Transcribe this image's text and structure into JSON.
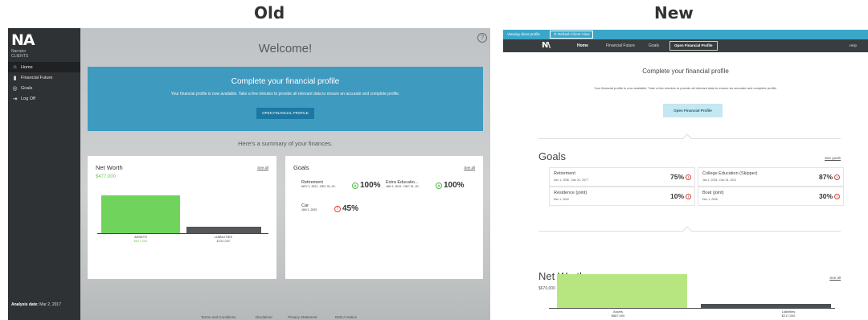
{
  "headings": {
    "old": "Old",
    "new": "New"
  },
  "old": {
    "logo": "NA",
    "logo_sub": "Narrator\nCLIENTS",
    "nav": [
      {
        "label": "Home",
        "icon": "home-icon",
        "glyph": "⌂"
      },
      {
        "label": "Financial Future",
        "icon": "chart-bar-icon",
        "glyph": "▮"
      },
      {
        "label": "Goals",
        "icon": "target-icon",
        "glyph": "◎"
      },
      {
        "label": "Log Off",
        "icon": "logout-icon",
        "glyph": "⇥"
      }
    ],
    "analysis_label": "Analysis date:",
    "analysis_date": "Mar 2, 2017",
    "help": "?",
    "welcome": "Welcome!",
    "banner": {
      "title": "Complete your financial profile",
      "text": "Your financial profile is now available. Take a few minutes to provide all relevant data to ensure an accurate and complete profile.",
      "button": "OPEN FINANCIAL PROFILE"
    },
    "summary": "Here's a summary of your finances.",
    "net_worth": {
      "title": "Net Worth",
      "see_all": "See all",
      "value": "$477,000",
      "assets_label": "ASSETS",
      "assets_value": "$627,000",
      "liabilities_label": "LIABILITIES",
      "liabilities_value": "$150,000",
      "assets_amount": 627000,
      "liabilities_amount": 150000
    },
    "goals": {
      "title": "Goals",
      "see_all": "See all",
      "items": [
        {
          "name": "Retirement",
          "dates": "NOV 1, 2021 - DEC 31, 20..",
          "pct": "100%",
          "status": "ok",
          "status_glyph": "▲"
        },
        {
          "name": "Extra Educatio...",
          "dates": "JAN 1, 2019 - DEC 31, 20..",
          "pct": "100%",
          "status": "ok",
          "status_glyph": "▲"
        },
        {
          "name": "Car",
          "dates": "JAN 1, 2020",
          "pct": "45%",
          "status": "bad",
          "status_glyph": "!"
        }
      ]
    },
    "footer": [
      "Terms and Conditions",
      "Disclaimer",
      "Privacy Statement",
      "DMCA Notice"
    ]
  },
  "new": {
    "viewing": "Viewing client profile",
    "refresh": "⟳ Refresh Client View",
    "logo": "N\\",
    "nav": [
      "Home",
      "Financial Future",
      "Goals"
    ],
    "nav_button": "Open Financial Profile",
    "help": "Help",
    "cfp_title": "Complete your financial profile",
    "cfp_text": "Your financial profile is now available. Take a few minutes to provide all relevant data to ensure an accurate and complete profile.",
    "cfp_button": "Open Financial Profile",
    "goals": {
      "title": "Goals",
      "see_all": "See goals",
      "items": [
        {
          "name": "Retirement",
          "dates": "Dec 1, 2036 - Dec 31, 2077",
          "pct": "75%"
        },
        {
          "name": "College Education (Skipper)",
          "dates": "Jan 1, 2018 - Dec 31, 2021",
          "pct": "87%"
        },
        {
          "name": "Residence (joint)",
          "dates": "Dec 1, 2022",
          "pct": "10%"
        },
        {
          "name": "Boat (joint)",
          "dates": "Dec 1, 2026",
          "pct": "30%"
        }
      ],
      "alert_glyph": "!"
    },
    "net_worth": {
      "title": "Net Worth",
      "see_all": "See all",
      "value": "$670,000",
      "assets_label": "Assets",
      "assets_value": "$887,000",
      "liabilities_label": "Liabilities",
      "liabilities_value": "$217,000",
      "assets_amount": 887000,
      "liabilities_amount": 217000
    }
  },
  "colors": {
    "old_banner": "#3f9ac0",
    "old_assets": "#6fd35c",
    "new_topbar": "#3ba7c8",
    "new_assets": "#b7e681",
    "alert": "#d9453c",
    "ok": "#52b848"
  }
}
